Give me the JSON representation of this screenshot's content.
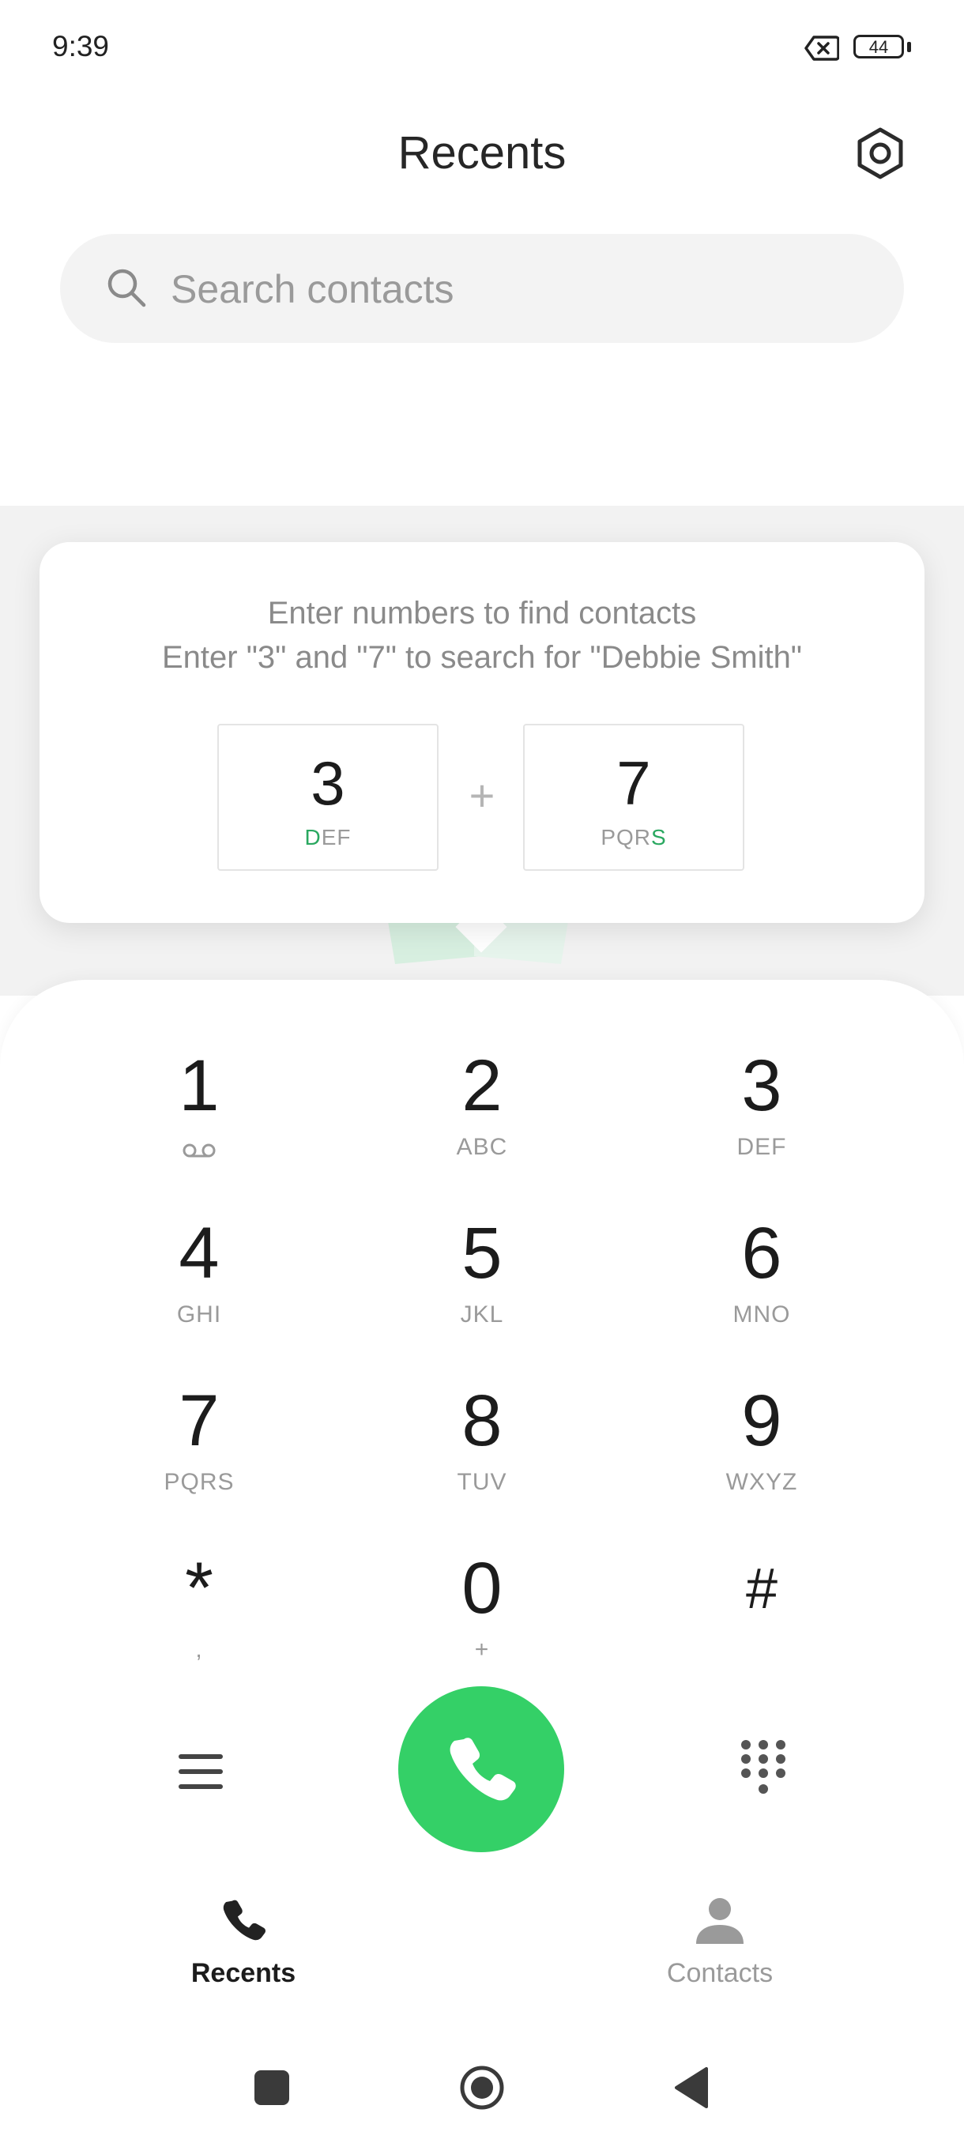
{
  "status_bar": {
    "time": "9:39",
    "battery_level": "44"
  },
  "header": {
    "title": "Recents"
  },
  "search": {
    "placeholder": "Search contacts"
  },
  "hint": {
    "line1": "Enter numbers to find contacts",
    "line2": "Enter \"3\" and \"7\" to search for \"Debbie Smith\"",
    "key1": {
      "digit": "3",
      "letters_highlight": "D",
      "letters_rest": "EF"
    },
    "plus": "+",
    "key2": {
      "digit": "7",
      "letters_rest": "PQR",
      "letters_highlight": "S"
    }
  },
  "dialpad": {
    "keys": [
      {
        "digit": "1",
        "letters": ""
      },
      {
        "digit": "2",
        "letters": "ABC"
      },
      {
        "digit": "3",
        "letters": "DEF"
      },
      {
        "digit": "4",
        "letters": "GHI"
      },
      {
        "digit": "5",
        "letters": "JKL"
      },
      {
        "digit": "6",
        "letters": "MNO"
      },
      {
        "digit": "7",
        "letters": "PQRS"
      },
      {
        "digit": "8",
        "letters": "TUV"
      },
      {
        "digit": "9",
        "letters": "WXYZ"
      },
      {
        "digit": "*",
        "letters": ","
      },
      {
        "digit": "0",
        "letters": "+"
      },
      {
        "digit": "#",
        "letters": ""
      }
    ]
  },
  "bottom_nav": {
    "recents_label": "Recents",
    "contacts_label": "Contacts"
  },
  "colors": {
    "accent_green": "#34d067",
    "highlight_green": "#2aa860",
    "text_gray": "#9a9a9a"
  }
}
